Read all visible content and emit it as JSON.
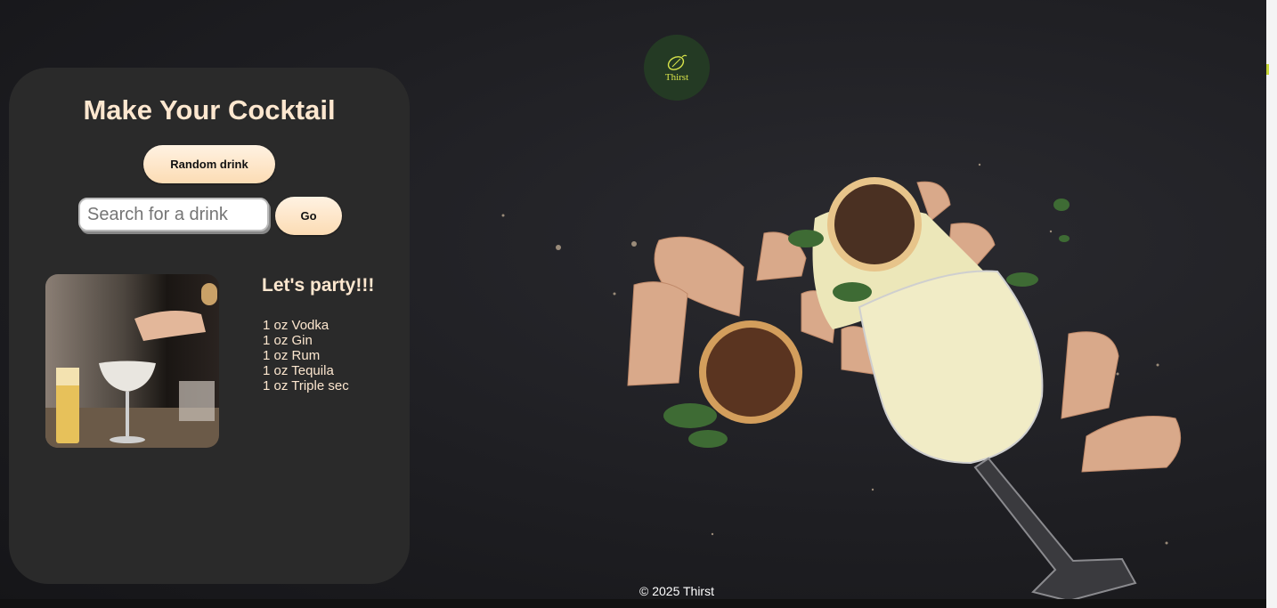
{
  "brand": {
    "logo_text": "Thirst"
  },
  "panel": {
    "title": "Make Your Cocktail",
    "random_button": "Random drink",
    "search": {
      "placeholder": "Search for a drink",
      "value": ""
    },
    "go_button": "Go"
  },
  "drink": {
    "name": "Let's party!!!",
    "ingredients": [
      "1 oz Vodka",
      "1 oz Gin",
      "1 oz Rum",
      "1 oz Tequila",
      "1 oz Triple sec"
    ]
  },
  "footer": {
    "text": "© 2025 Thirst"
  },
  "colors": {
    "accent": "#fde7cf",
    "button": "#fcdcb4",
    "logo_bg": "#243a24",
    "panel": "#2a2a2a"
  }
}
